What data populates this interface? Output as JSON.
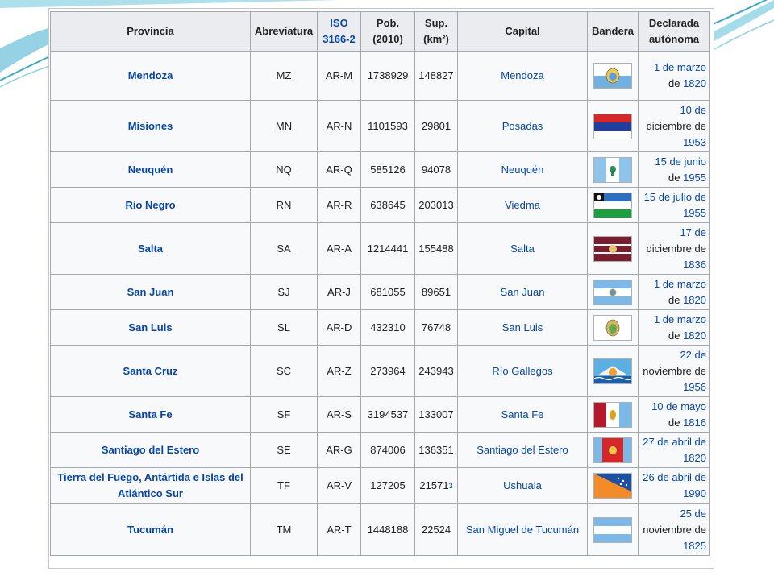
{
  "header": {
    "provincia": "Provincia",
    "abreviatura": "Abreviatura",
    "iso_l1": "ISO",
    "iso_l2": "3166-2",
    "pob_l1": "Pob.",
    "pob_l2": "(2010)",
    "sup_l1": "Sup.",
    "sup_l2": "(km²)",
    "capital": "Capital",
    "bandera": "Bandera",
    "decl_l1": "Declarada",
    "decl_l2": "autónoma"
  },
  "rows": [
    {
      "provincia": "Mendoza",
      "abrev": "MZ",
      "iso": "AR-M",
      "pob": "1738929",
      "sup": "148827",
      "capital": "Mendoza",
      "date_a": "1 de marzo",
      "date_b": "de ",
      "date_c": "1820"
    },
    {
      "provincia": "Misiones",
      "abrev": "MN",
      "iso": "AR-N",
      "pob": "1101593",
      "sup": "29801",
      "capital": "Posadas",
      "date_a": "10 de",
      "date_b": "diciembre de",
      "date_c": "1953"
    },
    {
      "provincia": "Neuquén",
      "abrev": "NQ",
      "iso": "AR-Q",
      "pob": "585126",
      "sup": "94078",
      "capital": "Neuquén",
      "date_a": "15 de junio",
      "date_b": "de ",
      "date_c": "1955"
    },
    {
      "provincia": "Río Negro",
      "abrev": "RN",
      "iso": "AR-R",
      "pob": "638645",
      "sup": "203013",
      "capital": "Viedma",
      "date_a": "15 de julio de",
      "date_b": "",
      "date_c": "1955"
    },
    {
      "provincia": "Salta",
      "abrev": "SA",
      "iso": "AR-A",
      "pob": "1214441",
      "sup": "155488",
      "capital": "Salta",
      "date_a": "17 de",
      "date_b": "diciembre de",
      "date_c": "1836"
    },
    {
      "provincia": "San Juan",
      "abrev": "SJ",
      "iso": "AR-J",
      "pob": "681055",
      "sup": "89651",
      "capital": "San Juan",
      "date_a": "1 de marzo",
      "date_b": "de ",
      "date_c": "1820"
    },
    {
      "provincia": "San Luis",
      "abrev": "SL",
      "iso": "AR-D",
      "pob": "432310",
      "sup": "76748",
      "capital": "San Luis",
      "date_a": "1 de marzo",
      "date_b": "de ",
      "date_c": "1820"
    },
    {
      "provincia": "Santa Cruz",
      "abrev": "SC",
      "iso": "AR-Z",
      "pob": "273964",
      "sup": "243943",
      "capital": "Río Gallegos",
      "date_a": "22 de",
      "date_b": "noviembre de",
      "date_c": "1956"
    },
    {
      "provincia": "Santa Fe",
      "abrev": "SF",
      "iso": "AR-S",
      "pob": "3194537",
      "sup": "133007",
      "capital": "Santa Fe",
      "date_a": "10 de mayo",
      "date_b": "de ",
      "date_c": "1816"
    },
    {
      "provincia": "Santiago del Estero",
      "abrev": "SE",
      "iso": "AR-G",
      "pob": "874006",
      "sup": "136351",
      "capital": "Santiago del Estero",
      "date_a": "27 de abril de",
      "date_b": "",
      "date_c": "1820"
    },
    {
      "provincia_l1": "Tierra del Fuego, Antártida e Islas del",
      "provincia_l2": "Atlántico Sur",
      "abrev": "TF",
      "iso": "AR-V",
      "pob": "127205",
      "sup": "21571",
      "sup_note": "3",
      "capital": "Ushuaia",
      "date_a": "26 de abril de",
      "date_b": "",
      "date_c": "1990"
    },
    {
      "provincia": "Tucumán",
      "abrev": "TM",
      "iso": "AR-T",
      "pob": "1448188",
      "sup": "22524",
      "capital": "San Miguel de Tucumán",
      "date_a": "25 de",
      "date_b": "noviembre de",
      "date_c": "1825"
    }
  ],
  "colors": {
    "link": "#0645ad",
    "header_bg": "#eaecf0",
    "cell_bg": "#f8f9fa",
    "border": "#a2a9b1",
    "accent_teal": "#5bc0d8"
  }
}
